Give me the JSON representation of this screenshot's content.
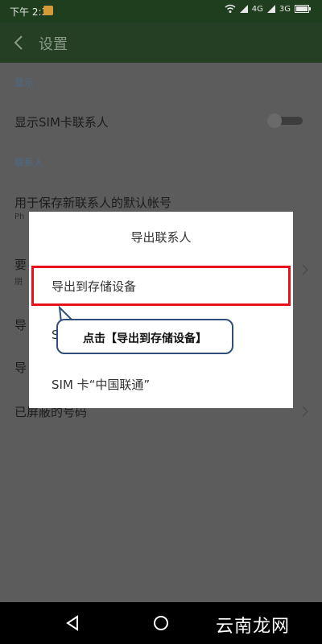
{
  "status_bar": {
    "time": "下午 2:30",
    "network_4g": "4G",
    "network_3g": "3G"
  },
  "app_bar": {
    "title": "设置"
  },
  "settings": {
    "section_display": "显示",
    "show_sim_contacts": "显示SIM卡联系人",
    "section_contacts": "联系人",
    "default_account_title": "用于保存新联系人的默认帐号",
    "default_account_sub": "Ph",
    "partial_items": [
      "要",
      "导",
      "导"
    ],
    "partial_sub": "朋",
    "blocked_numbers": "已屏蔽的号码"
  },
  "dialog": {
    "title": "导出联系人",
    "options": [
      "导出到存储设备",
      "S",
      "SIM 卡“中国联通”"
    ]
  },
  "callout": {
    "text": "点击【导出到存储设备】"
  },
  "watermark": {
    "text": "云南龙网"
  },
  "colors": {
    "status_bar": "#1f3e1e",
    "app_bar": "#243f24",
    "highlight": "#e8101a",
    "callout_border": "#2f4e7a"
  }
}
